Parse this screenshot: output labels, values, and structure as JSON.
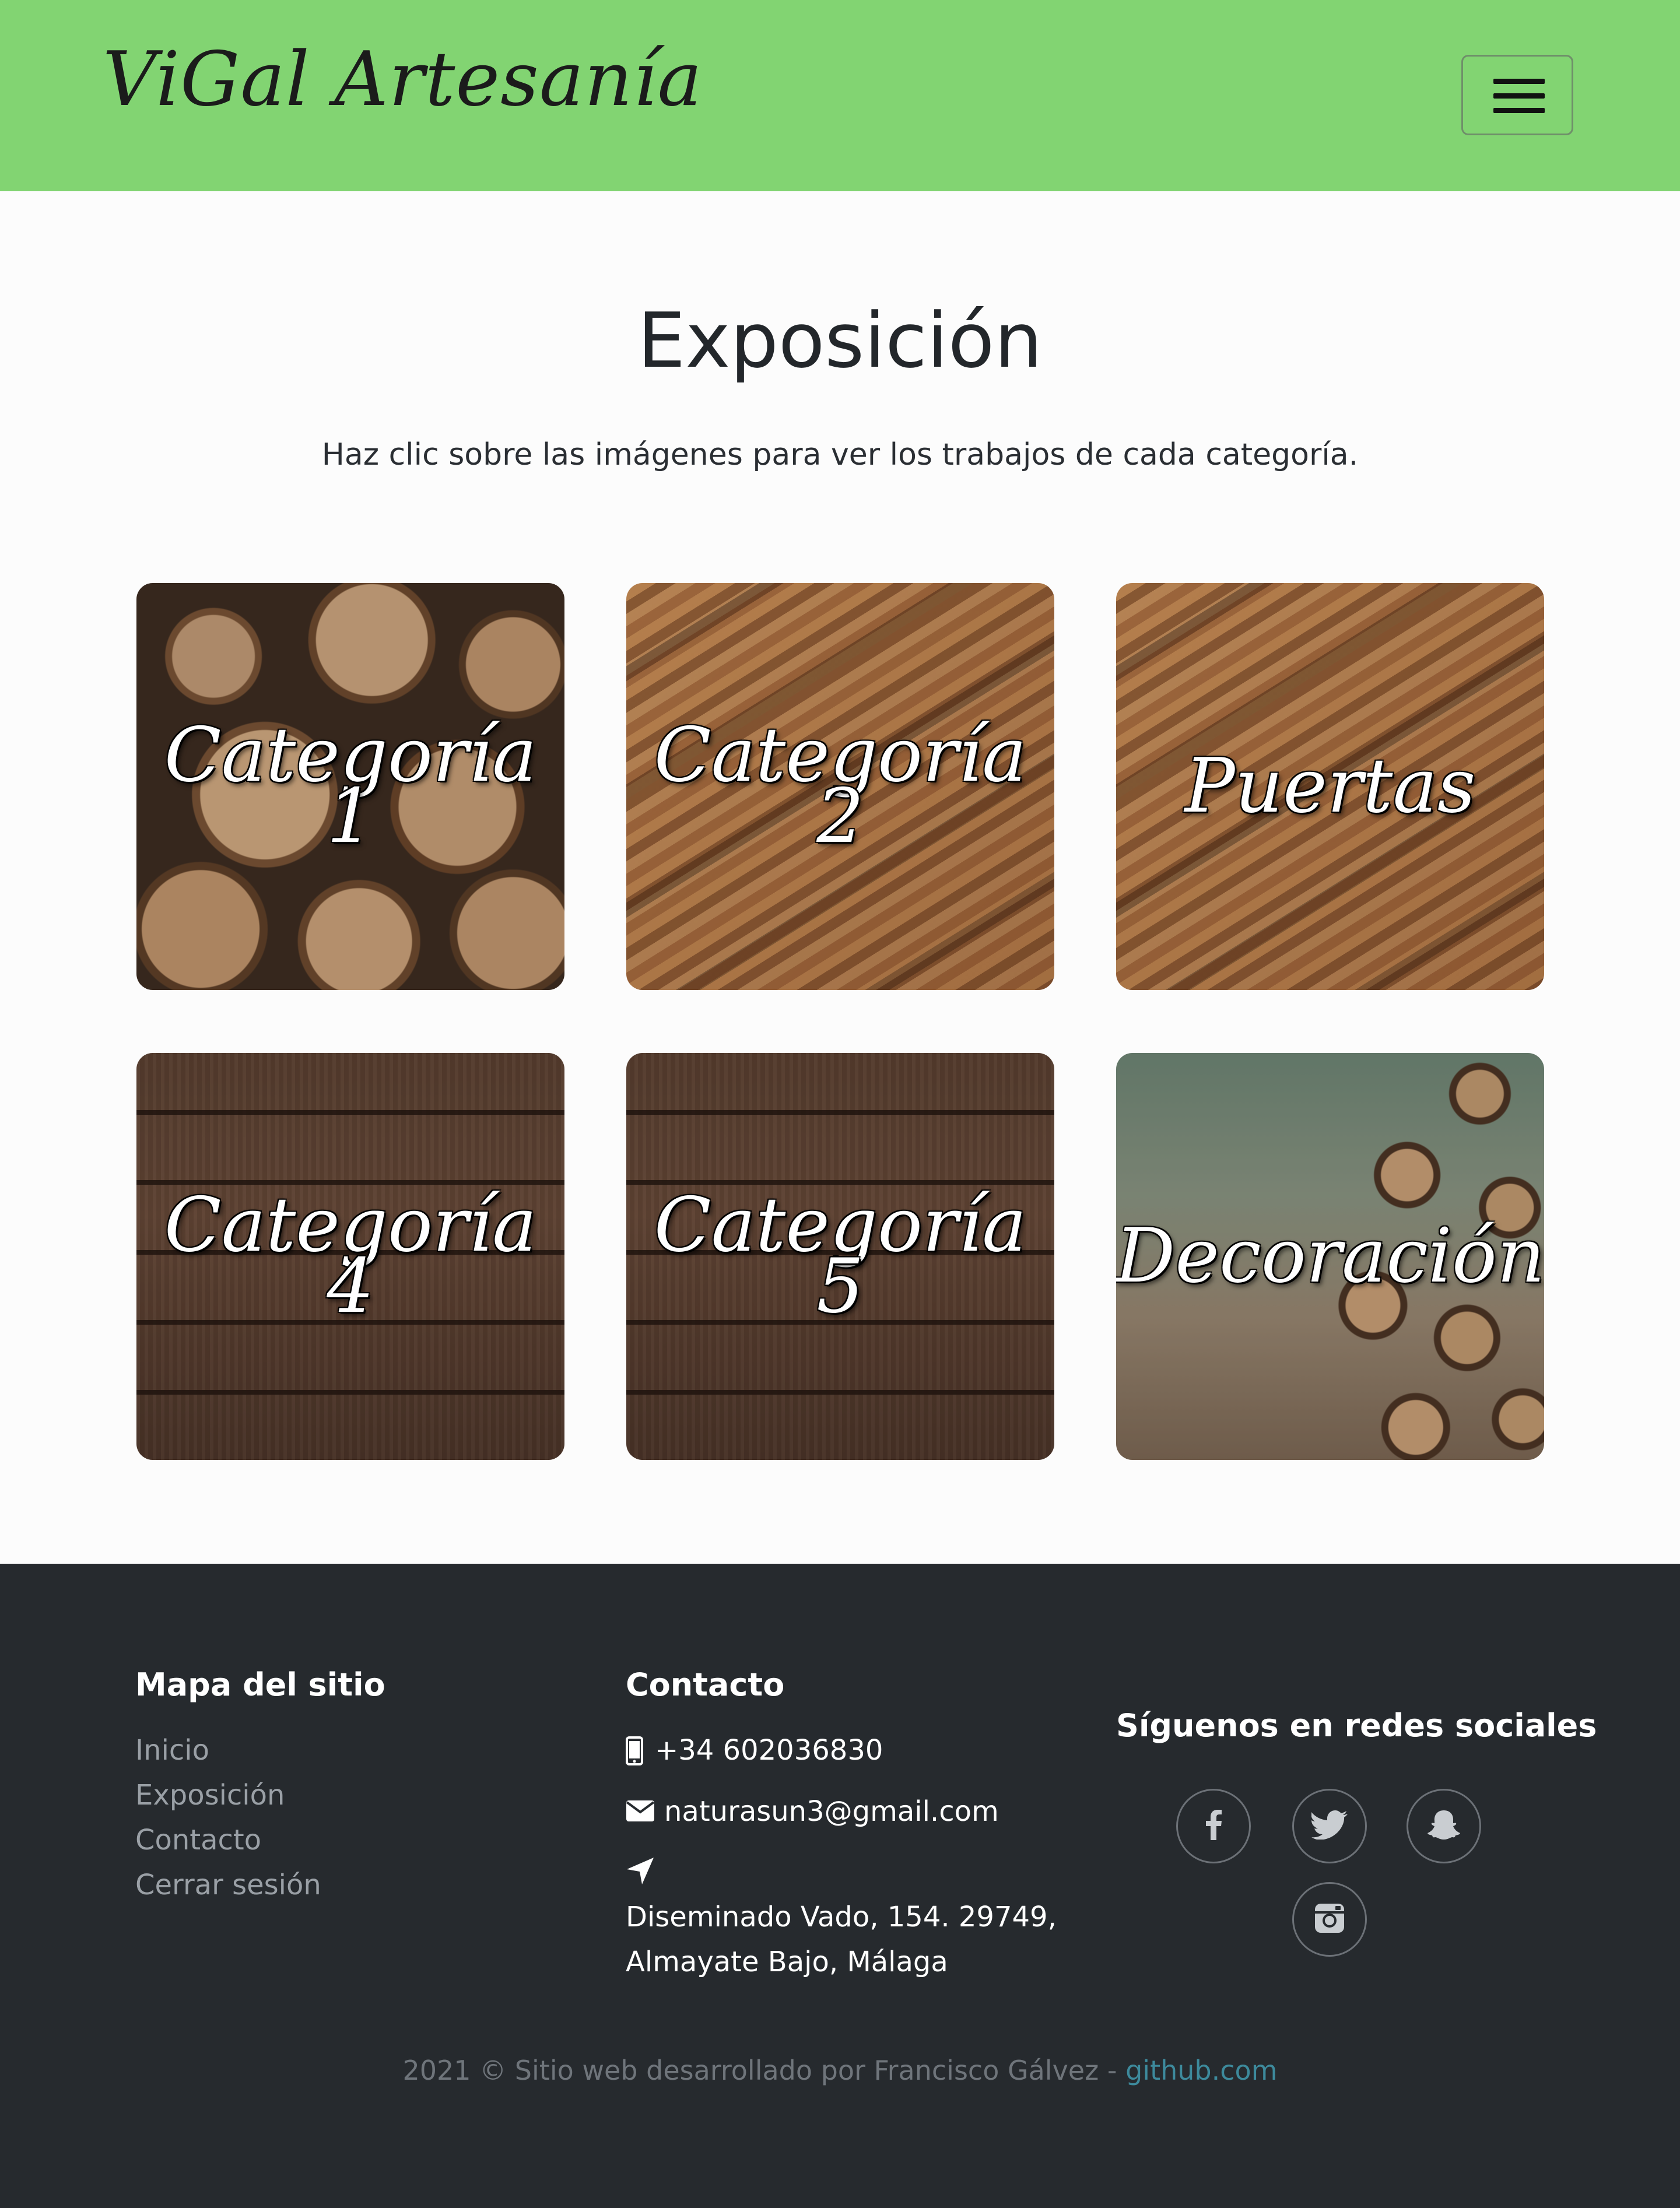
{
  "navbar": {
    "brand": "ViGal Artesanía",
    "toggle_icon": "hamburger-menu-icon",
    "background": "#82d472"
  },
  "main": {
    "title": "Exposición",
    "subtitle": "Haz clic sobre las imágenes para ver los trabajos de cada categoría.",
    "cards": [
      {
        "label": "Categoría 1",
        "image": "stacked-logs"
      },
      {
        "label": "Categoría 2",
        "image": "wood-planks"
      },
      {
        "label": "Puertas",
        "image": "wood-planks"
      },
      {
        "label": "Categoría 4",
        "image": "dark-wood-boards"
      },
      {
        "label": "Categoría 5",
        "image": "dark-wood-boards"
      },
      {
        "label": "Decoración",
        "image": "forest-log-pile"
      }
    ]
  },
  "footer": {
    "sitemap": {
      "title": "Mapa del sitio",
      "links": [
        "Inicio",
        "Exposición",
        "Contacto",
        "Cerrar sesión"
      ]
    },
    "contact": {
      "title": "Contacto",
      "phone": "+34 602036830",
      "email": "naturasun3@gmail.com",
      "address_line1": "Diseminado Vado, 154. 29749,",
      "address_line2": "Almayate Bajo, Málaga",
      "icons": [
        "mobile-phone-icon",
        "envelope-icon",
        "location-arrow-icon"
      ]
    },
    "social": {
      "title": "Síguenos en redes sociales",
      "networks": [
        "facebook-icon",
        "twitter-icon",
        "snapchat-icon",
        "instagram-icon"
      ]
    },
    "copyright_text": "2021 © Sitio web desarrollado por Francisco Gálvez - ",
    "copyright_link": "github.com",
    "background": "#262a2e",
    "link_color": "#3d8a9c"
  }
}
